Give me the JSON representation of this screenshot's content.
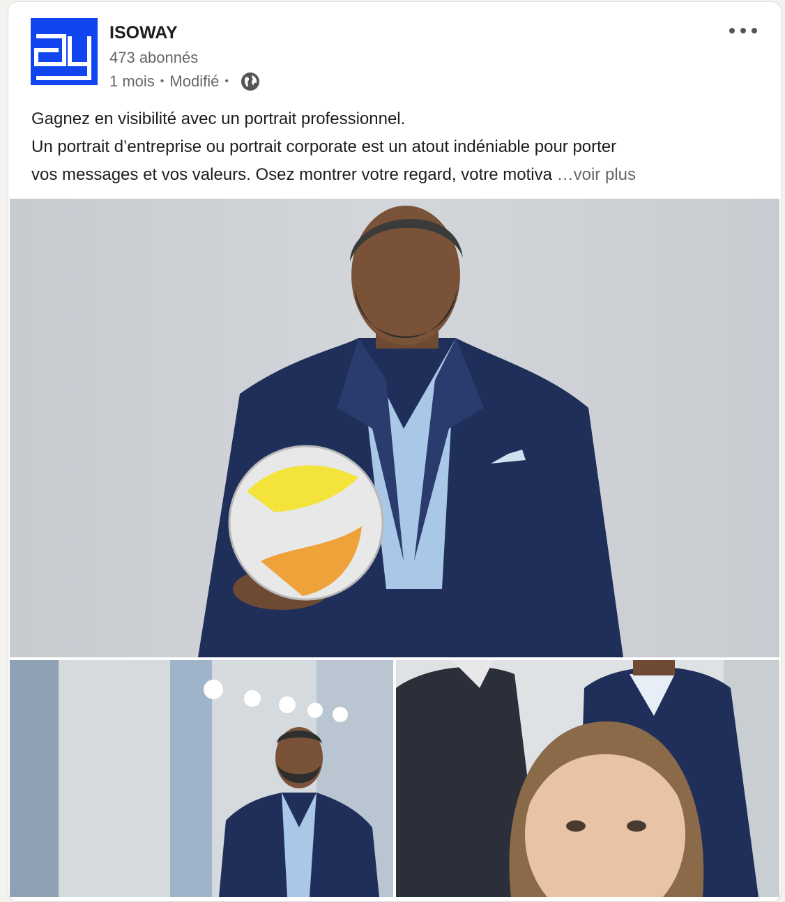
{
  "post": {
    "company_name": "ISOWAY",
    "followers": "473 abonnés",
    "age": "1 mois",
    "edited": "Modifié",
    "separator": "•",
    "visibility_icon": "globe-icon",
    "menu_icon": "ellipsis-icon",
    "text_line1": "Gagnez en visibilité avec un portrait professionnel.",
    "text_line2": "Un portrait d’entreprise ou portrait corporate est un atout indéniable pour porter",
    "text_line3": "vos messages et vos valeurs. Osez montrer votre regard, votre motiva",
    "see_more": "…voir plus"
  },
  "colors": {
    "brand_blue": "#1045f0",
    "text_primary": "#1d1d1d",
    "text_secondary": "#666666",
    "suit_navy": "#1f2f5a"
  },
  "images": [
    {
      "name": "main-portrait-photo"
    },
    {
      "name": "office-portrait-photo"
    },
    {
      "name": "group-selfie-photo"
    }
  ]
}
